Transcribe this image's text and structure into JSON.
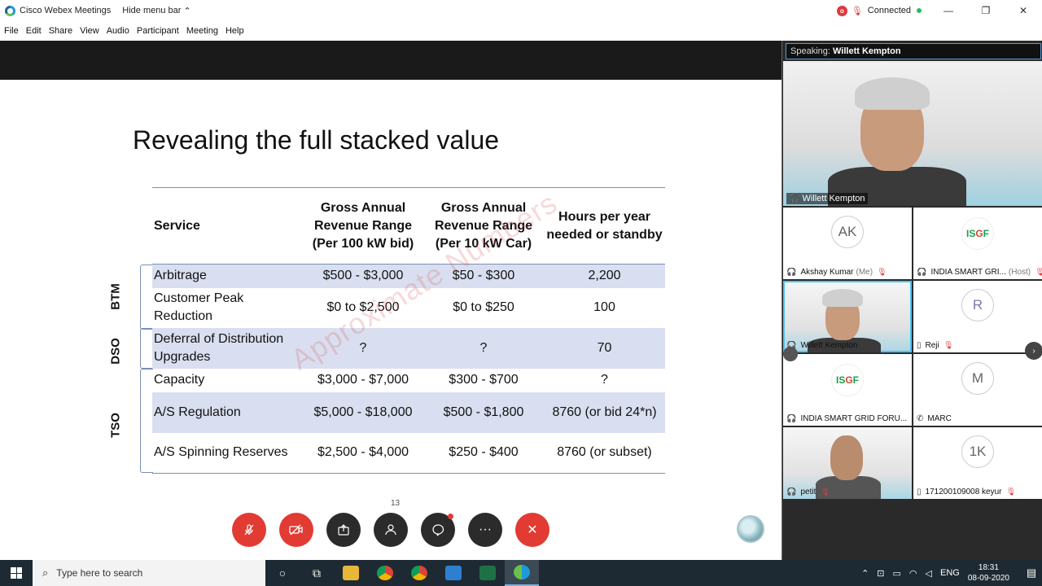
{
  "titlebar": {
    "app_name": "Cisco Webex Meetings",
    "hide_menu": "Hide menu bar",
    "status": "Connected"
  },
  "menu": [
    "File",
    "Edit",
    "Share",
    "View",
    "Audio",
    "Participant",
    "Meeting",
    "Help"
  ],
  "slide": {
    "title": "Revealing the full stacked value",
    "page_number": "13",
    "watermark": "Approximate Numbers",
    "headers": [
      "Service",
      "Gross Annual Revenue Range (Per 100 kW bid)",
      "Gross Annual Revenue Range (Per 10 kW Car)",
      "Hours per year needed or standby"
    ],
    "rows": [
      {
        "service": "Arbitrage",
        "rev100": "$500 - $3,000",
        "rev10": "$50 - $300",
        "hours": "2,200"
      },
      {
        "service": "Customer Peak Reduction",
        "rev100": "$0 to $2,500",
        "rev10": "$0 to $250",
        "hours": "100"
      },
      {
        "service": "Deferral of Distribution Upgrades",
        "rev100": "?",
        "rev10": "?",
        "hours": "70"
      },
      {
        "service": "Capacity",
        "rev100": "$3,000 - $7,000",
        "rev10": "$300 - $700",
        "hours": "?"
      },
      {
        "service": "A/S Regulation",
        "rev100": "$5,000 - $18,000",
        "rev10": "$500 - $1,800",
        "hours": "8760 (or bid 24*n)"
      },
      {
        "service": "A/S Spinning Reserves",
        "rev100": "$2,500 - $4,000",
        "rev10": "$250 - $400",
        "hours": "8760 (or subset)"
      }
    ],
    "groups": [
      "BTM",
      "DSO",
      "TSO"
    ]
  },
  "panel": {
    "speaking_label": "Speaking:",
    "speaking_name": "Willett Kempton",
    "main_name": "Willett Kempton",
    "participants": [
      {
        "initials": "AK",
        "name": "Akshay Kumar",
        "role": "(Me)"
      },
      {
        "initials": "ISGF",
        "name": "INDIA SMART GRI...",
        "role": "(Host)"
      },
      {
        "initials": "",
        "name": "Willett Kempton",
        "role": ""
      },
      {
        "initials": "R",
        "name": "Reji",
        "role": ""
      },
      {
        "initials": "ISGF",
        "name": "INDIA SMART GRID FORU...",
        "role": ""
      },
      {
        "initials": "M",
        "name": "MARC",
        "role": ""
      },
      {
        "initials": "",
        "name": "petit",
        "role": ""
      },
      {
        "initials": "1K",
        "name": "171200109008 keyur",
        "role": ""
      }
    ]
  },
  "taskbar": {
    "search_placeholder": "Type here to search",
    "lang": "ENG",
    "time": "18:31",
    "date": "08-09-2020"
  },
  "colors": {
    "accent_red": "#e23b33",
    "table_shade": "#d9dff0",
    "highlight": "#4fc3f7"
  }
}
